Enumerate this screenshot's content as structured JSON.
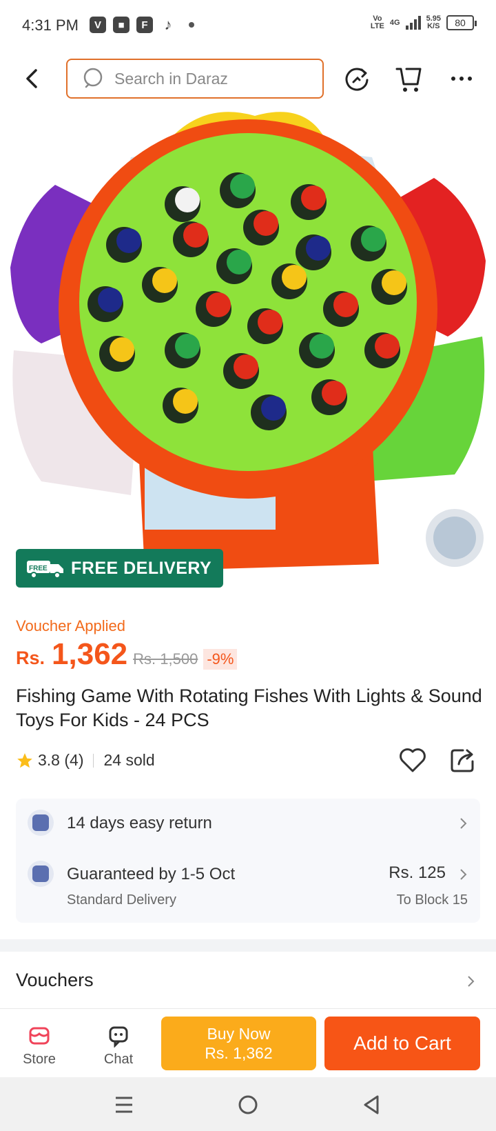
{
  "status_bar": {
    "time": "4:31 PM",
    "app_icons": [
      "V",
      "■",
      "F",
      "♪"
    ],
    "network_top": "Vo",
    "network_bottom": "LTE",
    "signal_top": "4G",
    "speed_top": "5.95",
    "speed_bottom": "K/S",
    "battery": "80"
  },
  "header": {
    "search_placeholder": "Search in Daraz"
  },
  "hero": {
    "badge_icon_text": "FREE",
    "badge_label": "FREE DELIVERY"
  },
  "price": {
    "voucher_label": "Voucher Applied",
    "currency": "Rs.",
    "amount": "1,362",
    "original": "Rs. 1,500",
    "discount": "-9%"
  },
  "product": {
    "title": "Fishing Game With Rotating Fishes With Lights & Sound Toys For Kids - 24 PCS",
    "rating": "3.8 (4)",
    "sold": "24 sold"
  },
  "service": {
    "return_text": "14 days easy return",
    "delivery_text": "Guaranteed by 1-5 Oct",
    "delivery_type": "Standard Delivery",
    "delivery_fee": "Rs. 125",
    "delivery_location": "To Block 15"
  },
  "vouchers": {
    "title": "Vouchers"
  },
  "bottom_bar": {
    "store_label": "Store",
    "chat_label": "Chat",
    "buy_now_label": "Buy Now",
    "buy_now_price": "Rs. 1,362",
    "add_to_cart_label": "Add to Cart"
  },
  "colors": {
    "accent": "#f4561b",
    "buy_now": "#fbab1b",
    "add_to_cart": "#f75516",
    "delivery_badge": "#137a5a"
  }
}
